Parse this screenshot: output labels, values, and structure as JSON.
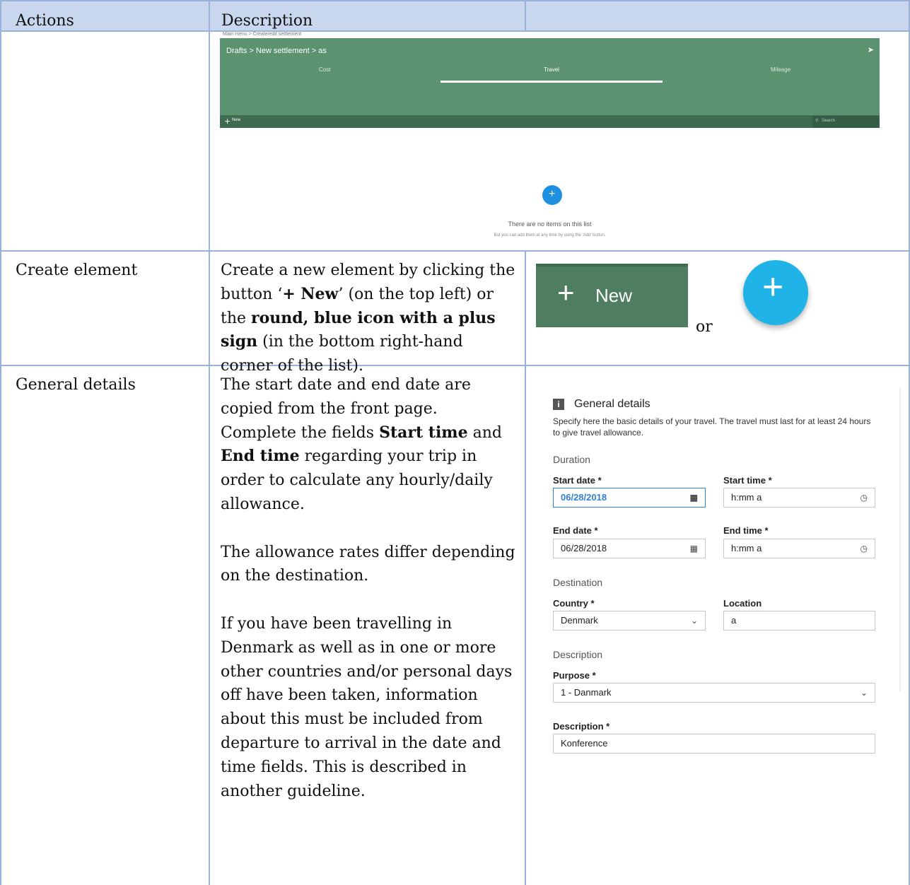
{
  "header": {
    "col1": "Actions",
    "col2": "Description"
  },
  "screenshot1": {
    "crumb_top": "Main menu  >  Create/edit settlement",
    "breadcrumb": "Drafts  >  New settlement  >  as",
    "tabs": [
      "Cost",
      "Travel",
      "Mileage"
    ],
    "new_label": "New",
    "search_placeholder": "Search",
    "empty_title": "There are no items on this list",
    "empty_sub": "But you can add them at any time by using the 'Add' button."
  },
  "row_create": {
    "action": "Create element",
    "desc_a": "Create a new element by clicking the button ‘",
    "desc_b": "+ New",
    "desc_c": "’ (on the top left) or the ",
    "desc_d": "round, blue icon with a plus sign",
    "desc_e": " (in the bottom right-hand corner of the list).",
    "new_button_label": "New",
    "or": "or"
  },
  "row_general": {
    "action": "General details",
    "p1a": "The start date and end date are copied from the front page. Complete the fields ",
    "p1b": "Start time",
    "p1c": " and ",
    "p1d": "End time",
    "p1e": " regarding your trip in order to calculate any hourly/daily allowance.",
    "p2": "The allowance rates differ depending on the destination.",
    "p3": "If you have been travelling in Denmark as well as in one or more other countries and/or personal days off have been taken, information about this must be included from departure to arrival in the date and time fields. This is described in another guideline."
  },
  "form": {
    "title": "General details",
    "intro": "Specify here the basic details of your travel. The travel must last for at least 24 hours to give travel allowance.",
    "duration": "Duration",
    "start_date_label": "Start date *",
    "start_date_value": "06/28/2018",
    "start_time_label": "Start time *",
    "start_time_value": "h:mm a",
    "end_date_label": "End date *",
    "end_date_value": "06/28/2018",
    "end_time_label": "End time *",
    "end_time_value": "h:mm a",
    "destination": "Destination",
    "country_label": "Country *",
    "country_value": "Denmark",
    "location_label": "Location",
    "location_value": "a",
    "description_section": "Description",
    "purpose_label": "Purpose *",
    "purpose_value": "1 - Danmark",
    "description_label": "Description *",
    "description_value": "Konference"
  },
  "colors": {
    "header_bg": "#c8d6ee",
    "rule": "#9ab2d8",
    "green": "#5b9270",
    "green_dark": "#3f6b50",
    "fab": "#1fb3e8",
    "blue_focus": "#2f7fd6"
  }
}
